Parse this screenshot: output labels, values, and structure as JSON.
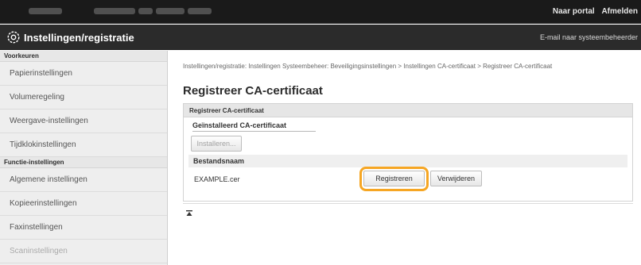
{
  "header": {
    "links": [
      "Naar portal",
      "Afmelden"
    ],
    "app_title": "Instellingen/registratie",
    "email_link": "E-mail naar systeembeheerder"
  },
  "sidebar": {
    "group1_label": "Voorkeuren",
    "group1_items": [
      "Papierinstellingen",
      "Volumeregeling",
      "Weergave-instellingen",
      "Tijdklokinstellingen"
    ],
    "group2_label": "Functie-instellingen",
    "group2_items": [
      "Algemene instellingen",
      "Kopieerinstellingen",
      "Faxinstellingen",
      "Scaninstellingen"
    ]
  },
  "main": {
    "breadcrumb": "Instellingen/registratie: Instellingen Systeembeheer: Beveiligingsinstellingen > Instellingen CA-certificaat > Registreer CA-certificaat",
    "title": "Registreer CA-certificaat",
    "panel_header": "Registreer CA-certificaat",
    "installed_label": "Geïnstalleerd CA-certificaat",
    "install_button": "Installeren...",
    "filename_header": "Bestandsnaam",
    "filename": "EXAMPLE.cer",
    "register_button": "Registreren",
    "delete_button": "Verwijderen"
  },
  "colors": {
    "highlight": "#f6a623",
    "header_bg": "#1a1a1a",
    "titlebar_bg": "#2b2b2b"
  }
}
